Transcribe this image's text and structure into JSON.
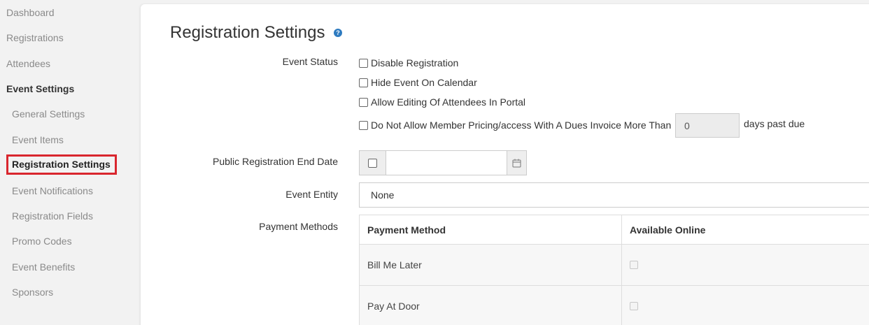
{
  "sidebar": {
    "items": [
      {
        "label": "Dashboard"
      },
      {
        "label": "Registrations"
      },
      {
        "label": "Attendees"
      },
      {
        "label": "Event Settings"
      },
      {
        "label": "General Settings"
      },
      {
        "label": "Event Items"
      },
      {
        "label": "Registration Settings"
      },
      {
        "label": "Event Notifications"
      },
      {
        "label": "Registration Fields"
      },
      {
        "label": "Promo Codes"
      },
      {
        "label": "Event Benefits"
      },
      {
        "label": "Sponsors"
      }
    ],
    "active": "Registration Settings"
  },
  "page": {
    "title": "Registration Settings",
    "help_icon": "question-circle-icon",
    "help_glyph": "?"
  },
  "event_status": {
    "label": "Event Status",
    "options": [
      {
        "label": "Disable Registration",
        "checked": false
      },
      {
        "label": "Hide Event On Calendar",
        "checked": false
      },
      {
        "label": "Allow Editing Of Attendees In Portal",
        "checked": false
      },
      {
        "label": "Do Not Allow Member Pricing/access With A Dues Invoice More Than",
        "checked": false
      }
    ],
    "days_value": "0",
    "days_suffix": "days past due"
  },
  "public_end_date": {
    "label": "Public Registration End Date",
    "checked": false,
    "value": "",
    "icon": "calendar-icon"
  },
  "event_entity": {
    "label": "Event Entity",
    "value": "None"
  },
  "payment_methods": {
    "label": "Payment Methods",
    "headers": [
      "Payment Method",
      "Available Online"
    ],
    "rows": [
      {
        "method": "Bill Me Later",
        "available_online": false
      },
      {
        "method": "Pay At Door",
        "available_online": false
      }
    ]
  },
  "colors": {
    "active_outline": "#d9262e",
    "help_icon": "#2e7bc0"
  }
}
